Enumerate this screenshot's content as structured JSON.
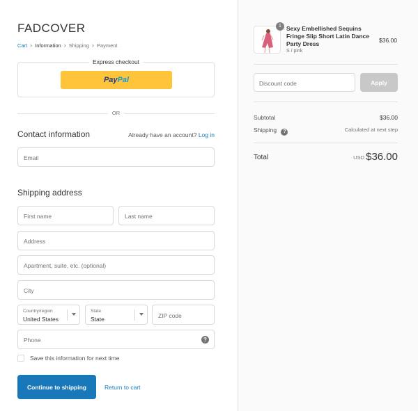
{
  "store": {
    "name": "FADCOVER"
  },
  "breadcrumb": {
    "cart": "Cart",
    "information": "Information",
    "shipping": "Shipping",
    "payment": "Payment"
  },
  "express": {
    "title": "Express checkout",
    "paypal_part1": "Pay",
    "paypal_part2": "Pal"
  },
  "divider_text": "OR",
  "contact": {
    "title": "Contact information",
    "account_prompt": "Already have an account?",
    "login_link": "Log in",
    "email_placeholder": "Email"
  },
  "shipping": {
    "title": "Shipping address",
    "first_name_placeholder": "First name",
    "last_name_placeholder": "Last name",
    "address_placeholder": "Address",
    "apartment_placeholder": "Apartment, suite, etc. (optional)",
    "city_placeholder": "City",
    "country_label": "Country/region",
    "country_value": "United States",
    "state_label": "State",
    "state_value": "State",
    "zip_placeholder": "ZIP code",
    "phone_placeholder": "Phone"
  },
  "save_info_label": "Save this information for next time",
  "actions": {
    "continue_label": "Continue to shipping",
    "return_label": "Return to cart"
  },
  "order": {
    "quantity": "1",
    "product_name": "Sexy Embellished Sequins Fringe Slip Short Latin Dance Party Dress",
    "variant": "S / pink",
    "price": "$36.00",
    "discount_placeholder": "Discount code",
    "apply_label": "Apply",
    "subtotal_label": "Subtotal",
    "subtotal_value": "$36.00",
    "shipping_label": "Shipping",
    "shipping_value": "Calculated at next step",
    "total_label": "Total",
    "currency": "USD",
    "total_value": "$36.00"
  },
  "colors": {
    "accent": "#1878b9",
    "link": "#197bbd",
    "paypal_yellow": "#ffc439",
    "sidebar_bg": "#fafafa"
  },
  "icons": {
    "breadcrumb_separator": "chevron-right-icon",
    "help": "question-circle-icon",
    "select_caret": "caret-down-icon"
  }
}
